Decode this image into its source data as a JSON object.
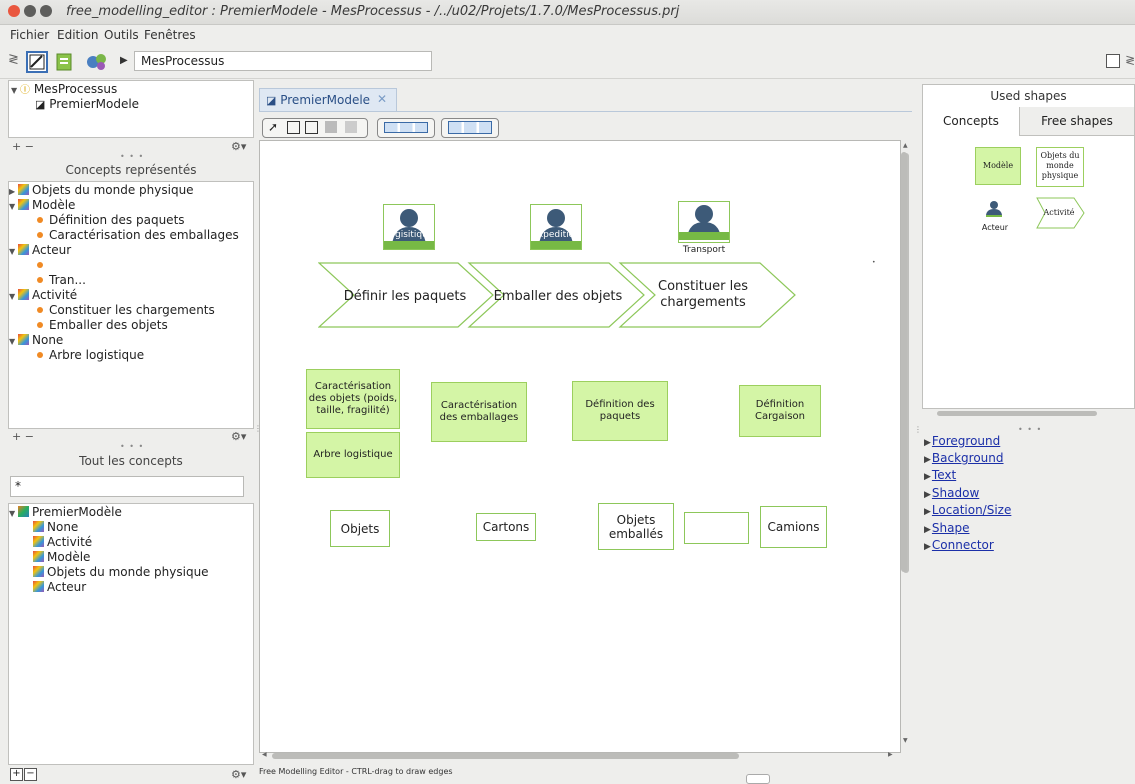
{
  "window": {
    "title": "free_modelling_editor : PremierModele - MesProcessus - /../u02/Projets/1.7.0/MesProcessus.prj"
  },
  "menu": [
    "Fichier",
    "Edition",
    "Outils",
    "Fenêtres"
  ],
  "toolbar": {
    "breadcrumb": "MesProcessus"
  },
  "project_tree": {
    "root": "MesProcessus",
    "child": "PremierModele"
  },
  "concepts_panel": {
    "header": "Concepts représentés",
    "items": [
      {
        "label": "Objets du monde physique",
        "level": 0,
        "expanded": false
      },
      {
        "label": "Modèle",
        "level": 0,
        "expanded": true
      },
      {
        "label": "Définition des paquets",
        "level": 1
      },
      {
        "label": "Caractérisation des emballages",
        "level": 1
      },
      {
        "label": "Acteur",
        "level": 0,
        "expanded": true
      },
      {
        "label": "",
        "level": 1
      },
      {
        "label": "Tran...",
        "level": 1
      },
      {
        "label": "Activité",
        "level": 0,
        "expanded": true
      },
      {
        "label": "Constituer les chargements",
        "level": 1
      },
      {
        "label": "Emballer des objets",
        "level": 1
      },
      {
        "label": "None",
        "level": 0,
        "expanded": true
      },
      {
        "label": "Arbre logistique",
        "level": 1
      }
    ]
  },
  "all_concepts": {
    "header": "Tout les concepts",
    "filter": "*",
    "root": "PremierModèle",
    "items": [
      "None",
      "Activité",
      "Modèle",
      "Objets du monde physique",
      "Acteur"
    ]
  },
  "editor": {
    "tab": "PremierModele",
    "actors": [
      "Logisitique",
      "Expedition",
      "Transport"
    ],
    "activities": [
      "Définir les paquets",
      "Emballer des objets",
      "Constituer les chargements"
    ],
    "models": [
      "Caractérisation des objets (poids, taille, fragilité)",
      "Arbre logistique",
      "Caractérisation des emballages",
      "Définition des paquets",
      "Définition Cargaison"
    ],
    "objects": [
      "Objets",
      "Cartons",
      "Objets emballés",
      "",
      "Camions"
    ],
    "status": "Free Modelling Editor - CTRL-drag to draw edges"
  },
  "used_shapes": {
    "header": "Used shapes",
    "tabs": [
      "Concepts",
      "Free shapes"
    ],
    "shapes": [
      "Modèle",
      "Objets du monde physique",
      "Acteur",
      "Activité"
    ]
  },
  "properties": [
    "Foreground",
    "Background",
    "Text",
    "Shadow",
    "Location/Size",
    "Shape",
    "Connector"
  ],
  "colors": {
    "model_fill": "#d4f5a6",
    "model_border": "#9ccf5e",
    "actor_bar": "#77b945",
    "link": "#1b2fa8"
  }
}
